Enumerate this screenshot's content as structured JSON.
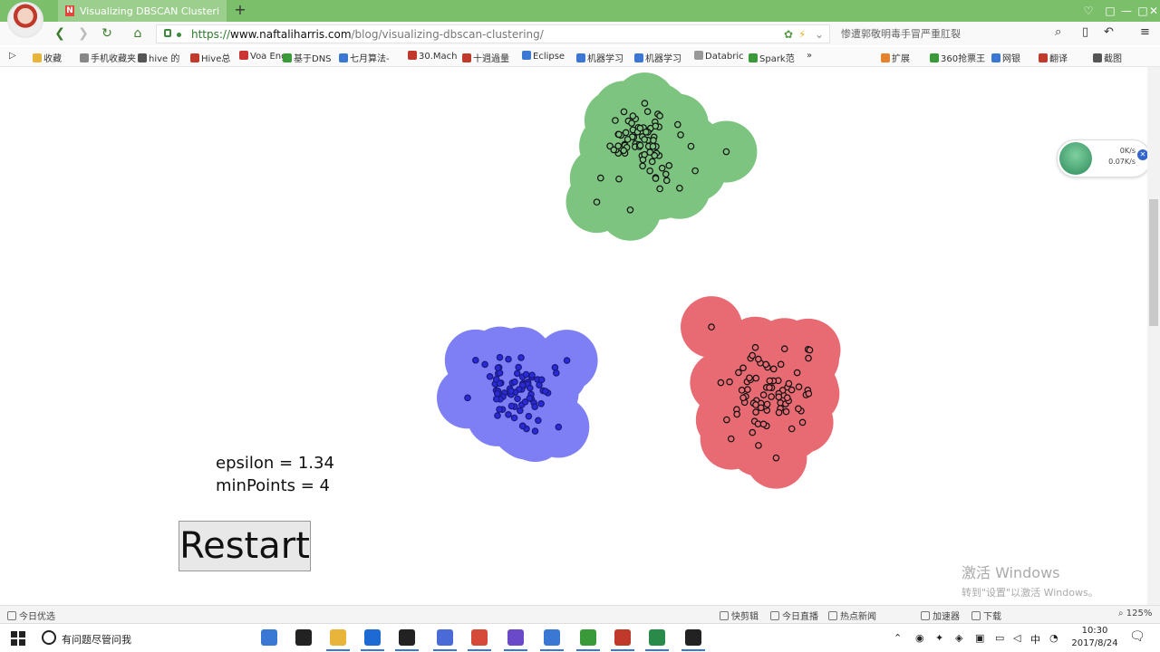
{
  "browser": {
    "tab_title": "Visualizing DBSCAN Clusteri",
    "tab_favicon_text": "N",
    "new_tab": "+",
    "window_controls": [
      "♡",
      "□",
      "—",
      "□",
      "✕"
    ],
    "url_scheme": "https://",
    "url_host": "www.naftaliharris.com",
    "url_path": "/blog/visualizing-dbscan-clustering/",
    "search_text": "惨遭郭敬明毒手冒严重肛裂"
  },
  "bookmarks": [
    {
      "label": "收藏",
      "color": "#e9b43a"
    },
    {
      "label": "手机收藏夹",
      "color": "#888888"
    },
    {
      "label": "hive 的",
      "color": "#555555"
    },
    {
      "label": "Hive总",
      "color": "#c0392b"
    },
    {
      "label": "Voa Eng",
      "color": "#cc3333"
    },
    {
      "label": "基于DNS",
      "color": "#3a9a3a"
    },
    {
      "label": "七月算法-",
      "color": "#3a78d4"
    },
    {
      "label": "30.Mach",
      "color": "#c0392b"
    },
    {
      "label": "十週過量",
      "color": "#c0392b"
    },
    {
      "label": "Eclipse",
      "color": "#3a78d4"
    },
    {
      "label": "机器学习",
      "color": "#3a78d4"
    },
    {
      "label": "机器学习",
      "color": "#3a78d4"
    },
    {
      "label": "Databric",
      "color": "#999999"
    },
    {
      "label": "Spark范",
      "color": "#3a9a3a"
    },
    {
      "label": "»",
      "color": ""
    },
    {
      "label": "扩展",
      "color": "#e6822e"
    },
    {
      "label": "360抢票王",
      "color": "#3a9a3a"
    },
    {
      "label": "网银",
      "color": "#3a78d4"
    },
    {
      "label": "翻译",
      "color": "#c0392b"
    },
    {
      "label": "截图",
      "color": "#555555"
    }
  ],
  "dbscan": {
    "epsilon_text": "epsilon = 1.34",
    "minpoints_text": "minPoints = 4",
    "epsilon": 1.34,
    "min_points": 4,
    "restart_label": "Restart",
    "clusters": [
      {
        "name": "green",
        "fill": "#7cc47f",
        "point_fill": "#2e4d2e",
        "point_style": "hollow",
        "n_points": 80
      },
      {
        "name": "blue",
        "fill": "#7f7ff5",
        "point_fill": "#2a2ad8",
        "point_style": "filled",
        "n_points": 80
      },
      {
        "name": "red",
        "fill": "#e86a72",
        "point_fill": "#5a1a1e",
        "point_style": "hollow",
        "n_points": 80
      }
    ]
  },
  "watermark": {
    "line1": "激活 Windows",
    "line2": "转到\"设置\"以激活 Windows。"
  },
  "net_widget": {
    "down": "0K/s",
    "up": "0.07K/s"
  },
  "statusbar": {
    "left": "今日优选",
    "items": [
      "快剪辑",
      "今日直播",
      "热点新闻",
      "加速器",
      "下载",
      "125%"
    ]
  },
  "taskbar": {
    "search_placeholder": "有问题尽管问我",
    "apps": [
      {
        "name": "mic",
        "color": "#3a78d4"
      },
      {
        "name": "taskview",
        "color": "#222222"
      },
      {
        "name": "explorer",
        "color": "#e9b43a"
      },
      {
        "name": "ie",
        "color": "#1e6ad4"
      },
      {
        "name": "store",
        "color": "#222222"
      },
      {
        "name": "qq",
        "color": "#4a6ad8"
      },
      {
        "name": "chrome",
        "color": "#d64a3a"
      },
      {
        "name": "app6",
        "color": "#6a4ac8"
      },
      {
        "name": "app7",
        "color": "#3a78d4"
      },
      {
        "name": "browser360",
        "color": "#3a9a3a"
      },
      {
        "name": "app9",
        "color": "#c0392b"
      },
      {
        "name": "excel",
        "color": "#2a8a4a"
      },
      {
        "name": "camtasia",
        "color": "#222222"
      }
    ],
    "ime": "中",
    "time": "10:30",
    "date": "2017/8/24"
  }
}
